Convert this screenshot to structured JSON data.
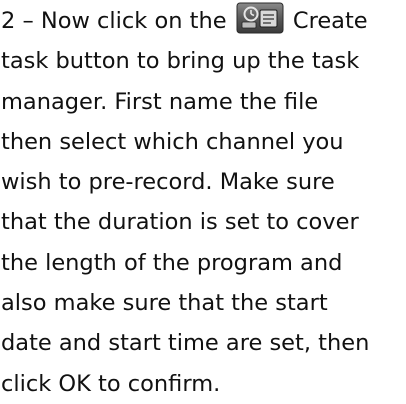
{
  "instruction": {
    "line1_before_icon": "2 – Now click on the",
    "line1_after_icon": "Create",
    "lines": [
      "task button to bring up the task",
      "manager. First name the file",
      "then select which channel you",
      "wish to pre-record. Make sure",
      "that the duration is set to cover",
      "the length of the program and",
      "also make sure that the start",
      "date and start time are set, then",
      "click OK to confirm."
    ],
    "icon": "create-task-icon"
  },
  "colors": {
    "text": "#111111",
    "icon_face": "#5a5a5a",
    "icon_border": "#2a2a2a"
  }
}
